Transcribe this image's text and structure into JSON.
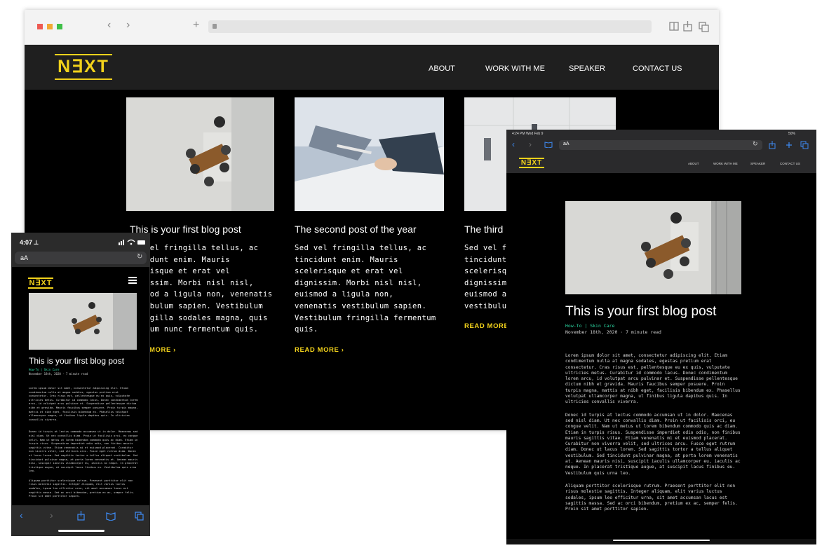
{
  "colors": {
    "accent": "#f2d21b",
    "tag": "#2bd4a0",
    "background": "#000000",
    "nav": "#1f1f1f"
  },
  "brand": {
    "logo": "N∃XT"
  },
  "nav": {
    "about": "ABOUT",
    "work": "WORK WITH ME",
    "speaker": "SPEAKER",
    "contact": "CONTACT US"
  },
  "posts": [
    {
      "title": "This is your first blog post",
      "excerpt": "Sed vel fringilla tellus, ac tincidunt enim. Mauris scelerisque et erat vel dignissim. Morbi nisl nisl, euismod a ligula non, venenatis vestibulum sapien. Vestibulum fringilla sodales magna, quis elementum nunc fermentum quis.",
      "visible_excerpt": "vel fringilla tellus, ac\nidunt enim. Mauris\nrisque et erat vel\nissim. Morbi nisl nisl,\nmod a ligula non, venenatis\nibulum sapien. Vestibulum\nngilla sodales magna, quis\nium nunc fermentum quis.",
      "readmore": "MORE ›"
    },
    {
      "title": "The second post of the year",
      "excerpt": "Sed vel fringilla tellus, ac\ntincidunt enim. Mauris\nscelerisque et erat vel\ndignissim. Morbi nisl nisl,\neuismod a ligula non,\nvenenatis vestibulum sapien.\nVestibulum fringilla fermentum\nquis.",
      "readmore": "READ MORE ›"
    },
    {
      "title": "The third",
      "excerpt": "Sed vel fl\ntincidunt\nscelerisq\ndignissim\neuismod a\nvestibulum",
      "readmore": "READ MORE ›"
    }
  ],
  "phone": {
    "status_time": "4:07 ⟂",
    "address": "aA",
    "menu_icon": "hamburger-icon",
    "post_title": "This is your first blog post",
    "tags": "How-To | Skin Care",
    "meta": "November 18th, 2020 · 7 minute read",
    "body": [
      "Lorem ipsum dolor sit amet, consectetur adipiscing elit. Etiam condimentum nulla at magna sodales, egestas pretium erat consectetur. Cras risus est, pellentesque eu ex quis, vulputate ultricies metus. Curabitur id commodo lacus. Donec condimentum lorem arcu, id volutpat arcu pulvinar et. Suspendisse pellentesque dictum nibh et gravida. Mauris faucibus semper posuere. Proin turpis magna, mattis at nibh eget, facilisis bibendum ex. Phasellus volutpat ullamcorper magna, ut finibus ligula dapibus quis. In ultricies convallis viverra.",
      "Donec id turpis at lectus commodo accumsan ut in dolor. Maecenas sed nisl diam. Ut nec convallis diam. Proin ut facilisis orci, eu congue velit. Nam ut metus ut lorem bibendum commodo quis ac diam. Etiam in turpis risus. Suspendisse imperdiet odio odio, non finibus mauris sagittis vitae. Etiam venenatis mi et euismod placerat. Curabitur non viverra velit, sed ultrices arcu. Fusce eget rutrum diam. Donec ut lacus lorem. Sed sagittis tortor a tellus aliquet vestibulum. Sed tincidunt pulvinar magna, at porta lorem venenatis at. Aenean mauris nisi, suscipit iaculis ullamcorper eu, iaculis ac neque. In placerat tristique augue, at suscipit lacus finibus eu. Vestibulum quis urna leo.",
      "Aliquam porttitor scelerisque rutrum. Praesent porttitor elit non risus molestie sagittis. Integer aliquam, elit varius luctus sodales, ipsum leo efficitur urna, sit amet accumsan lacus est sagittis massa. Sed ac orci bibendum, pretium ex ac, semper felis. Proin sit amet porttitor sapien."
    ]
  },
  "tablet": {
    "status_time": "4:24 PM  Wed Feb 9",
    "status_right": "50%",
    "address": "aA",
    "post_title": "This is your first blog post",
    "tags": "How-To | Skin Care",
    "meta": "November 18th, 2020 · 7 minute read",
    "body": [
      "Lorem ipsum dolor sit amet, consectetur adipiscing elit. Etiam condimentum nulla at magna sodales, egestas pretium erat consectetur. Cras risus est, pellentesque eu ex quis, vulputate ultricies metus. Curabitur id commodo lacus. Donec condimentum lorem arcu, id volutpat arcu pulvinar et. Suspendisse pellentesque dictum nibh et gravida. Mauris faucibus semper posuere. Proin turpis magna, mattis at nibh eget, facilisis bibendum ex. Phasellus volutpat ullamcorper magna, ut finibus ligula dapibus quis. In ultricies convallis viverra.",
      "Donec id turpis at lectus commodo accumsan ut in dolor. Maecenas sed nisl diam. Ut nec convallis diam. Proin ut facilisis orci, eu congue velit. Nam ut metus ut lorem bibendum commodo quis ac diam. Etiam in turpis risus. Suspendisse imperdiet odio odio, non finibus mauris sagittis vitae. Etiam venenatis mi et euismod placerat. Curabitur non viverra velit, sed ultrices arcu. Fusce eget rutrum diam. Donec ut lacus lorem. Sed sagittis tortor a tellus aliquet vestibulum. Sed tincidunt pulvinar magna, at porta lorem venenatis at. Aenean mauris nisi, suscipit iaculis ullamcorper eu, iaculis ac neque. In placerat tristique augue, at suscipit lacus finibus eu. Vestibulum quis urna leo.",
      "Aliquam porttitor scelerisque rutrum. Praesent porttitor elit non risus molestie sagittis. Integer aliquam, elit varius luctus sodales, ipsum leo efficitur urna, sit amet accumsan lacus est sagittis massa. Sed ac orci bibendum, pretium ex ac, semper felis. Proin sit amet porttitor sapien."
    ]
  }
}
